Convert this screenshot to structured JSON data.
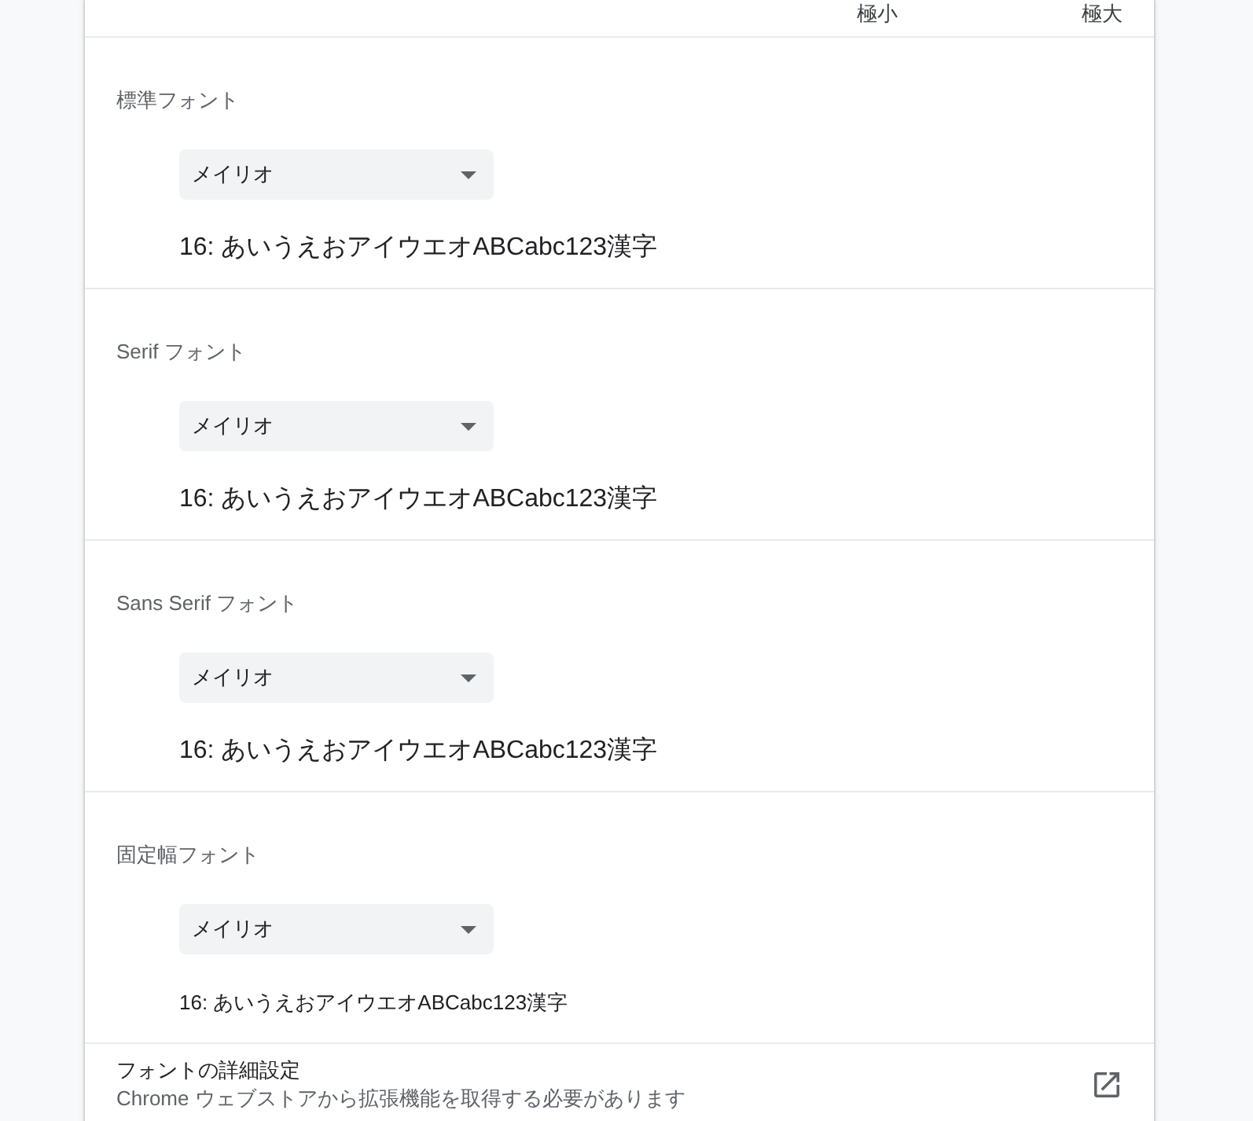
{
  "size_scale": {
    "min_label": "極小",
    "max_label": "極大"
  },
  "font_settings": [
    {
      "label": "標準フォント",
      "value": "メイリオ",
      "sample": "16: あいうえおアイウエオABCabc123漢字",
      "kind": "proportional"
    },
    {
      "label": "Serif フォント",
      "value": "メイリオ",
      "sample": "16: あいうえおアイウエオABCabc123漢字",
      "kind": "proportional"
    },
    {
      "label": "Sans Serif フォント",
      "value": "メイリオ",
      "sample": "16: あいうえおアイウエオABCabc123漢字",
      "kind": "proportional"
    },
    {
      "label": "固定幅フォント",
      "value": "メイリオ",
      "sample": "16: あいうえおアイウエオABCabc123漢字",
      "kind": "fixed"
    }
  ],
  "advanced": {
    "title": "フォントの詳細設定",
    "description": "Chrome ウェブストアから拡張機能を取得する必要があります"
  }
}
